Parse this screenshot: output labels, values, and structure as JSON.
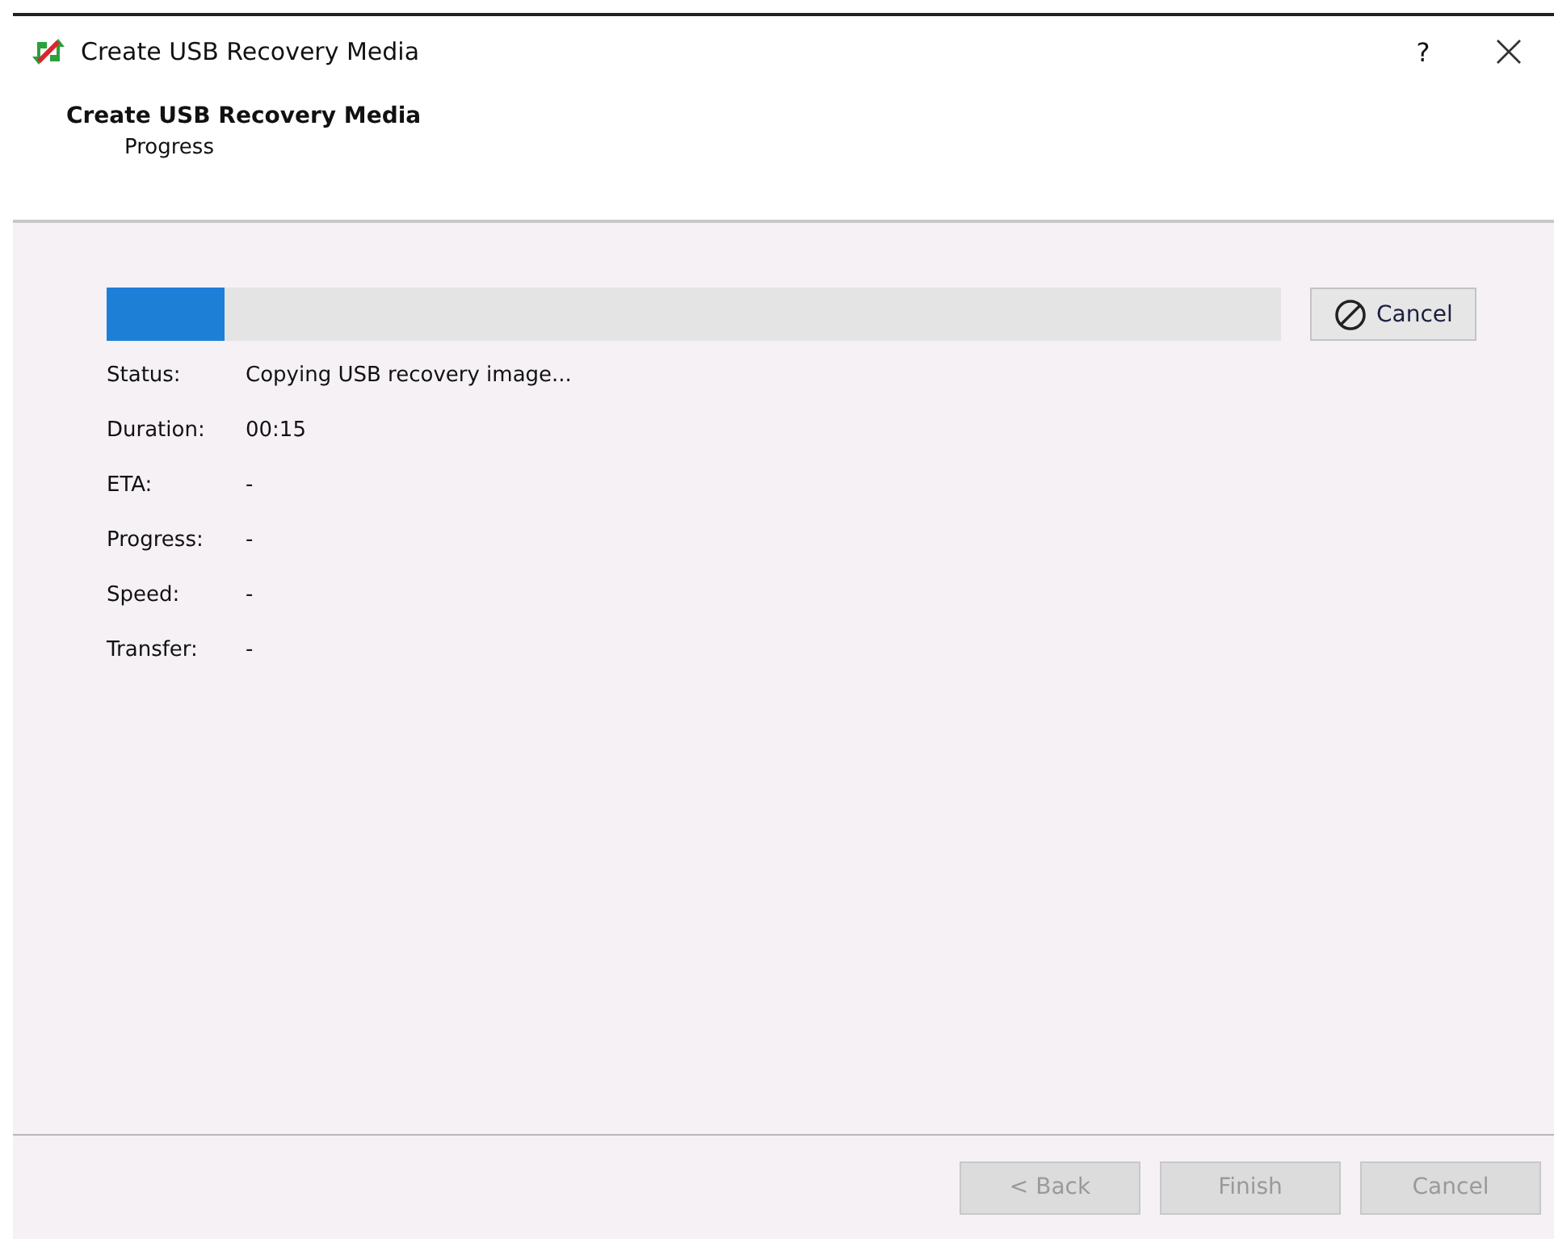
{
  "window": {
    "title": "Create USB Recovery Media",
    "help": "?"
  },
  "header": {
    "title": "Create USB Recovery Media",
    "subtitle": "Progress"
  },
  "progress": {
    "level": 0.1
  },
  "cancel_button": {
    "label": "Cancel",
    "disabled": false
  },
  "details": [
    {
      "label": "Status:",
      "value": "Copying USB recovery image..."
    },
    {
      "label": "Duration:",
      "value": "00:15"
    },
    {
      "label": "ETA:",
      "value": "-"
    },
    {
      "label": "Progress:",
      "value": "-"
    },
    {
      "label": "Speed:",
      "value": "-"
    },
    {
      "label": "Transfer:",
      "value": "-"
    }
  ],
  "buttons": [
    {
      "label": "< Back",
      "disabled": true
    },
    {
      "label": "Finish",
      "disabled": true
    },
    {
      "label": "Cancel",
      "disabled": true
    }
  ]
}
